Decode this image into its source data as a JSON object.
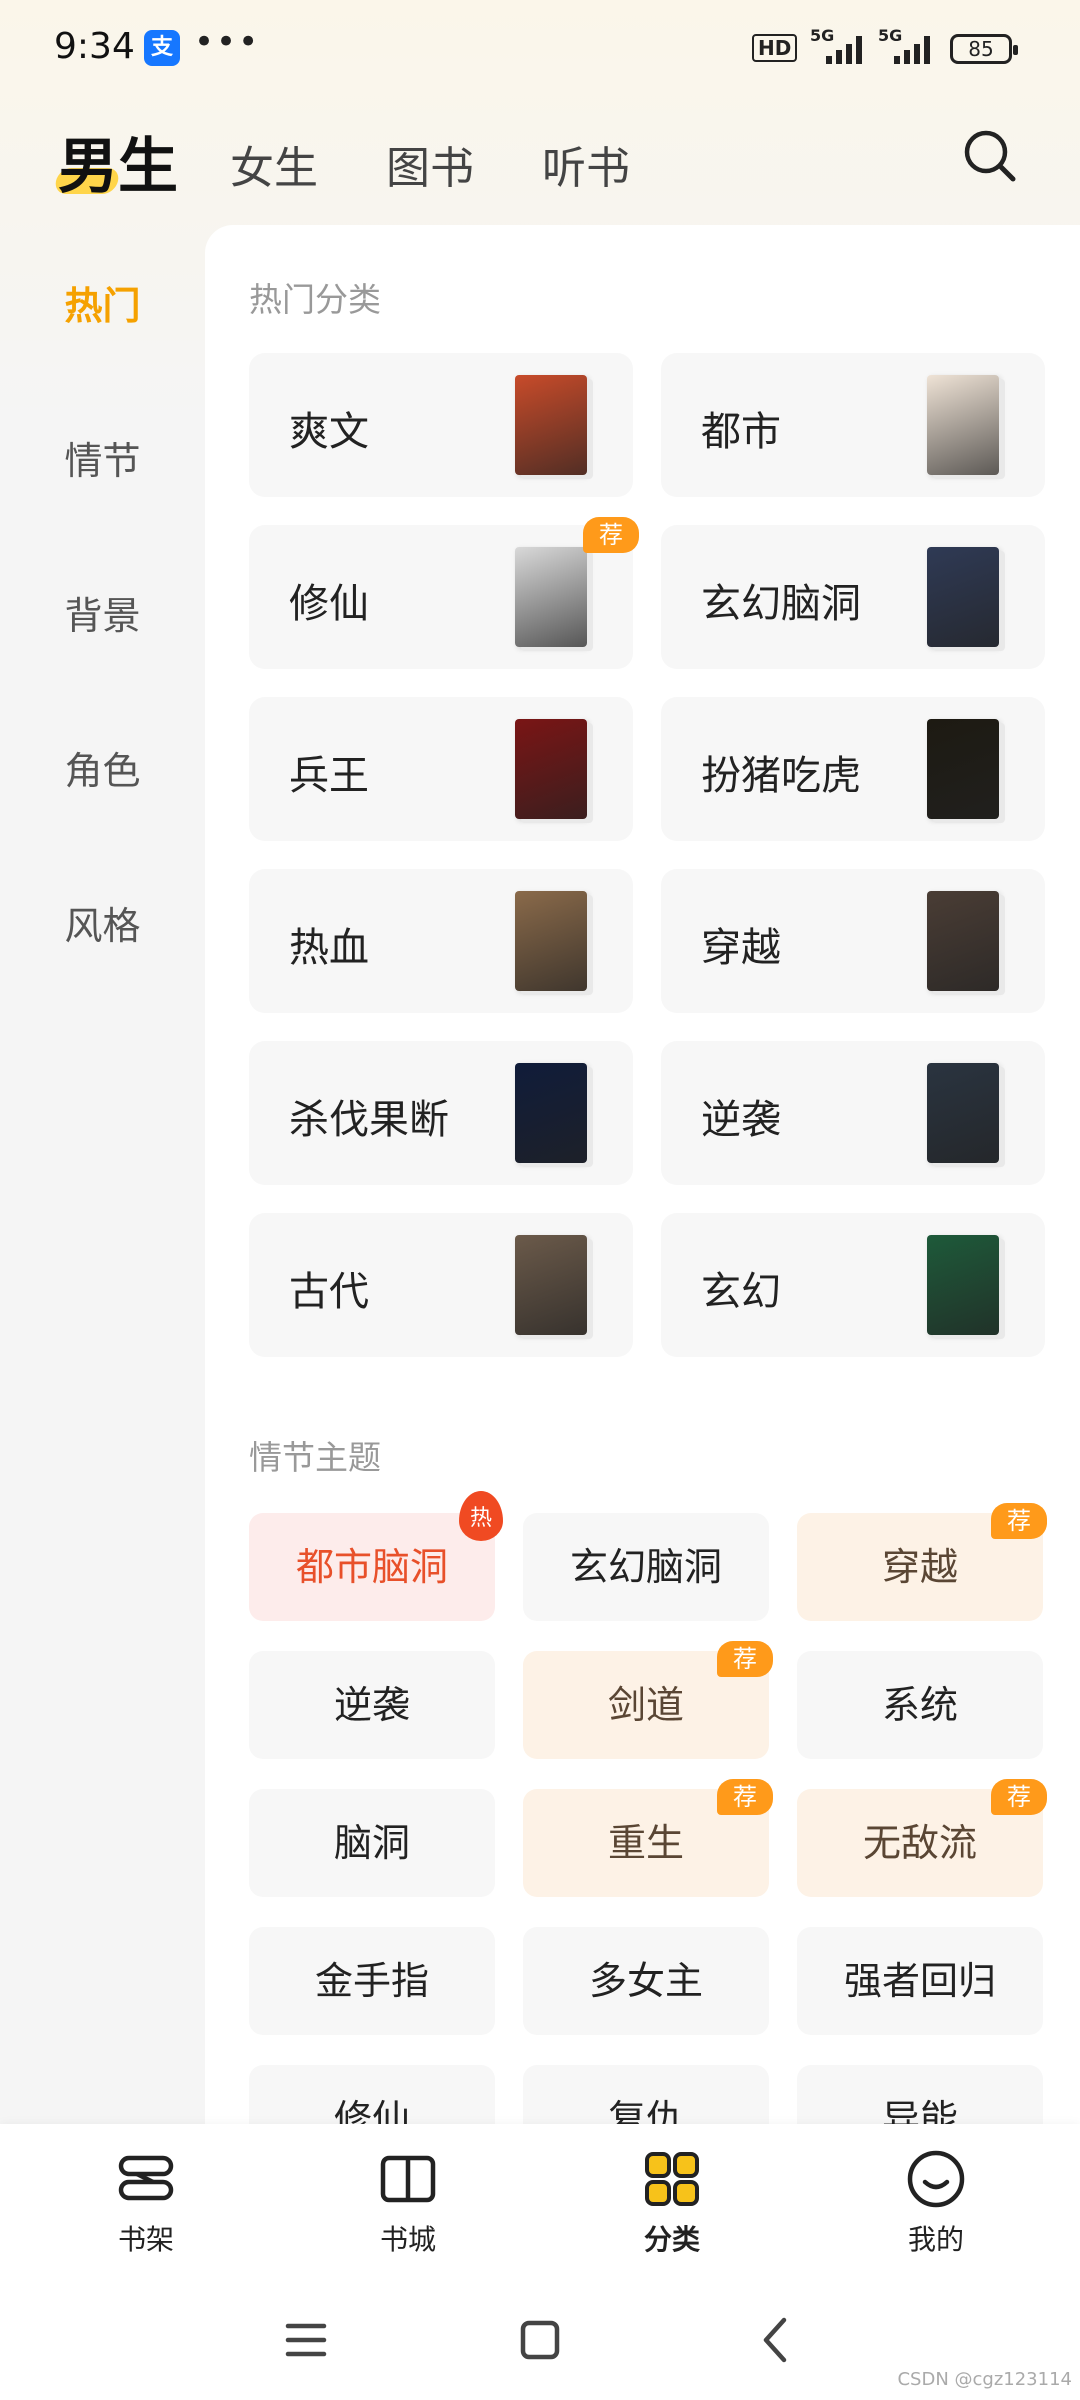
{
  "status_bar": {
    "time": "9:34",
    "alipay_icon_text": "支",
    "more": "•••",
    "hd_label": "HD",
    "network_1": "5G",
    "network_2": "5G",
    "battery": "85"
  },
  "top_tabs": [
    {
      "label": "男生",
      "active": true
    },
    {
      "label": "女生",
      "active": false
    },
    {
      "label": "图书",
      "active": false
    },
    {
      "label": "听书",
      "active": false
    }
  ],
  "left_nav": [
    {
      "label": "热门",
      "active": true
    },
    {
      "label": "情节",
      "active": false
    },
    {
      "label": "背景",
      "active": false
    },
    {
      "label": "角色",
      "active": false
    },
    {
      "label": "风格",
      "active": false
    }
  ],
  "hot_categories": {
    "title": "热门分类",
    "recommend_badge": "荐",
    "items": [
      {
        "label": "爽文",
        "cover_color": "#c84b2a",
        "badge": false
      },
      {
        "label": "都市",
        "cover_color": "#efe3d6",
        "badge": false
      },
      {
        "label": "修仙",
        "cover_color": "#d9d9d9",
        "badge": true
      },
      {
        "label": "玄幻脑洞",
        "cover_color": "#2f3a55",
        "badge": false
      },
      {
        "label": "兵王",
        "cover_color": "#7a1515",
        "badge": false
      },
      {
        "label": "扮猪吃虎",
        "cover_color": "#1d1a12",
        "badge": false
      },
      {
        "label": "热血",
        "cover_color": "#8a6a4a",
        "badge": false
      },
      {
        "label": "穿越",
        "cover_color": "#4a3d35",
        "badge": false
      },
      {
        "label": "杀伐果断",
        "cover_color": "#101c3a",
        "badge": false
      },
      {
        "label": "逆袭",
        "cover_color": "#2a3440",
        "badge": false
      },
      {
        "label": "古代",
        "cover_color": "#6b5a4a",
        "badge": false
      },
      {
        "label": "玄幻",
        "cover_color": "#1e5a3a",
        "badge": false
      }
    ]
  },
  "plot_themes": {
    "title": "情节主题",
    "hot_badge": "热",
    "recommend_badge": "荐",
    "items": [
      {
        "label": "都市脑洞",
        "style": "hot",
        "badge": "hot"
      },
      {
        "label": "玄幻脑洞",
        "style": "plain",
        "badge": ""
      },
      {
        "label": "穿越",
        "style": "warm",
        "badge": "rec"
      },
      {
        "label": "逆袭",
        "style": "plain",
        "badge": ""
      },
      {
        "label": "剑道",
        "style": "warm",
        "badge": "rec"
      },
      {
        "label": "系统",
        "style": "plain",
        "badge": ""
      },
      {
        "label": "脑洞",
        "style": "plain",
        "badge": ""
      },
      {
        "label": "重生",
        "style": "warm",
        "badge": "rec"
      },
      {
        "label": "无敌流",
        "style": "warm",
        "badge": "rec"
      },
      {
        "label": "金手指",
        "style": "plain",
        "badge": ""
      },
      {
        "label": "多女主",
        "style": "plain",
        "badge": ""
      },
      {
        "label": "强者回归",
        "style": "plain",
        "badge": ""
      },
      {
        "label": "修仙",
        "style": "plain",
        "badge": ""
      },
      {
        "label": "复仇",
        "style": "plain",
        "badge": ""
      },
      {
        "label": "异能",
        "style": "plain",
        "badge": ""
      }
    ]
  },
  "bottom_nav": [
    {
      "label": "书架",
      "icon": "bookshelf-icon",
      "active": false
    },
    {
      "label": "书城",
      "icon": "book-open-icon",
      "active": false
    },
    {
      "label": "分类",
      "icon": "category-grid-icon",
      "active": true
    },
    {
      "label": "我的",
      "icon": "smile-face-icon",
      "active": false
    }
  ],
  "colors": {
    "accent_orange": "#f5a100",
    "badge_orange": "#ff9a1a",
    "hot_red": "#e8502a",
    "category_active_icon": "#f7c21a"
  },
  "watermark": "CSDN @cgz123114"
}
